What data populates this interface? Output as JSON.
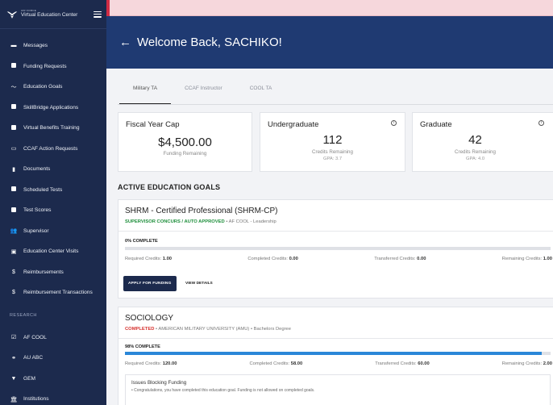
{
  "sidebar": {
    "logo_small": "AIR FORCE",
    "logo_title": "Virtual Education Center",
    "items": [
      {
        "label": "Messages",
        "icon": "message-icon"
      },
      {
        "label": "Funding Requests",
        "icon": "document-icon"
      },
      {
        "label": "Education Goals",
        "icon": "trend-icon"
      },
      {
        "label": "SkillBridge Applications",
        "icon": "document-icon"
      },
      {
        "label": "Virtual Benefits Training",
        "icon": "training-icon"
      },
      {
        "label": "CCAF Action Requests",
        "icon": "folder-icon"
      },
      {
        "label": "Documents",
        "icon": "file-icon"
      },
      {
        "label": "Scheduled Tests",
        "icon": "calendar-icon"
      },
      {
        "label": "Test Scores",
        "icon": "score-icon"
      },
      {
        "label": "Supervisor",
        "icon": "people-icon"
      },
      {
        "label": "Education Center Visits",
        "icon": "calendar-icon"
      },
      {
        "label": "Reimbursements",
        "icon": "dollar-icon"
      },
      {
        "label": "Reimbursement Transactions",
        "icon": "dollar-icon"
      }
    ],
    "research_heading": "RESEARCH",
    "research_items": [
      {
        "label": "AF COOL",
        "icon": "check-icon"
      },
      {
        "label": "AU ABC",
        "icon": "handshake-icon"
      },
      {
        "label": "GEM",
        "icon": "filter-icon"
      },
      {
        "label": "Institutions",
        "icon": "institution-icon"
      }
    ]
  },
  "header": {
    "welcome": "Welcome Back, SACHIKO!"
  },
  "tabs": [
    {
      "label": "Military TA",
      "active": true
    },
    {
      "label": "CCAF Instructor",
      "active": false
    },
    {
      "label": "COOL TA",
      "active": false
    }
  ],
  "summary": {
    "fiscal": {
      "title": "Fiscal Year Cap",
      "amount": "$4,500.00",
      "sub": "Funding Remaining"
    },
    "undergrad": {
      "title": "Undergraduate",
      "value": "112",
      "sub": "Credits Remaining",
      "gpa_label": "GPA:",
      "gpa": "3.7"
    },
    "graduate": {
      "title": "Graduate",
      "value": "42",
      "sub": "Credits Remaining",
      "gpa_label": "GPA:",
      "gpa": "4.0"
    }
  },
  "section_title": "ACTIVE EDUCATION GOALS",
  "goals": [
    {
      "title": "SHRM - Certified Professional (SHRM-CP)",
      "status": "SUPERVISOR CONCURS / AUTO APPROVED",
      "detail": "AF COOL - Leadership",
      "percent_label": "0% COMPLETE",
      "percent": 0,
      "required_label": "Required Credits:",
      "required": "1.00",
      "completed_label": "Completed Credits:",
      "completed": "0.00",
      "transferred_label": "Transferred Credits:",
      "transferred": "0.00",
      "remaining_label": "Remaining Credits:",
      "remaining": "1.00",
      "apply_label": "APPLY FOR FUNDING",
      "details_label": "VIEW DETAILS"
    },
    {
      "title": "SOCIOLOGY",
      "status": "COMPLETED",
      "detail1": "AMERICAN MILITARY UNIVERSITY (AMU)",
      "detail2": "Bachelors Degree",
      "percent_label": "98% COMPLETE",
      "percent": 98,
      "required_label": "Required Credits:",
      "required": "120.00",
      "completed_label": "Completed Credits:",
      "completed": "58.00",
      "transferred_label": "Transferred Credits:",
      "transferred": "60.00",
      "remaining_label": "Remaining Credits:",
      "remaining": "2.00",
      "issues_title": "Issues Blocking Funding",
      "issues_text": "Congratulations, you have completed this education goal. Funding is not allowed on completed goals."
    }
  ],
  "colors": {
    "sidebar": "#1c2a4d",
    "header": "#1f3a72",
    "progress": "#2a87d8",
    "approved": "#1f8f3c",
    "completed": "#d6322f"
  }
}
